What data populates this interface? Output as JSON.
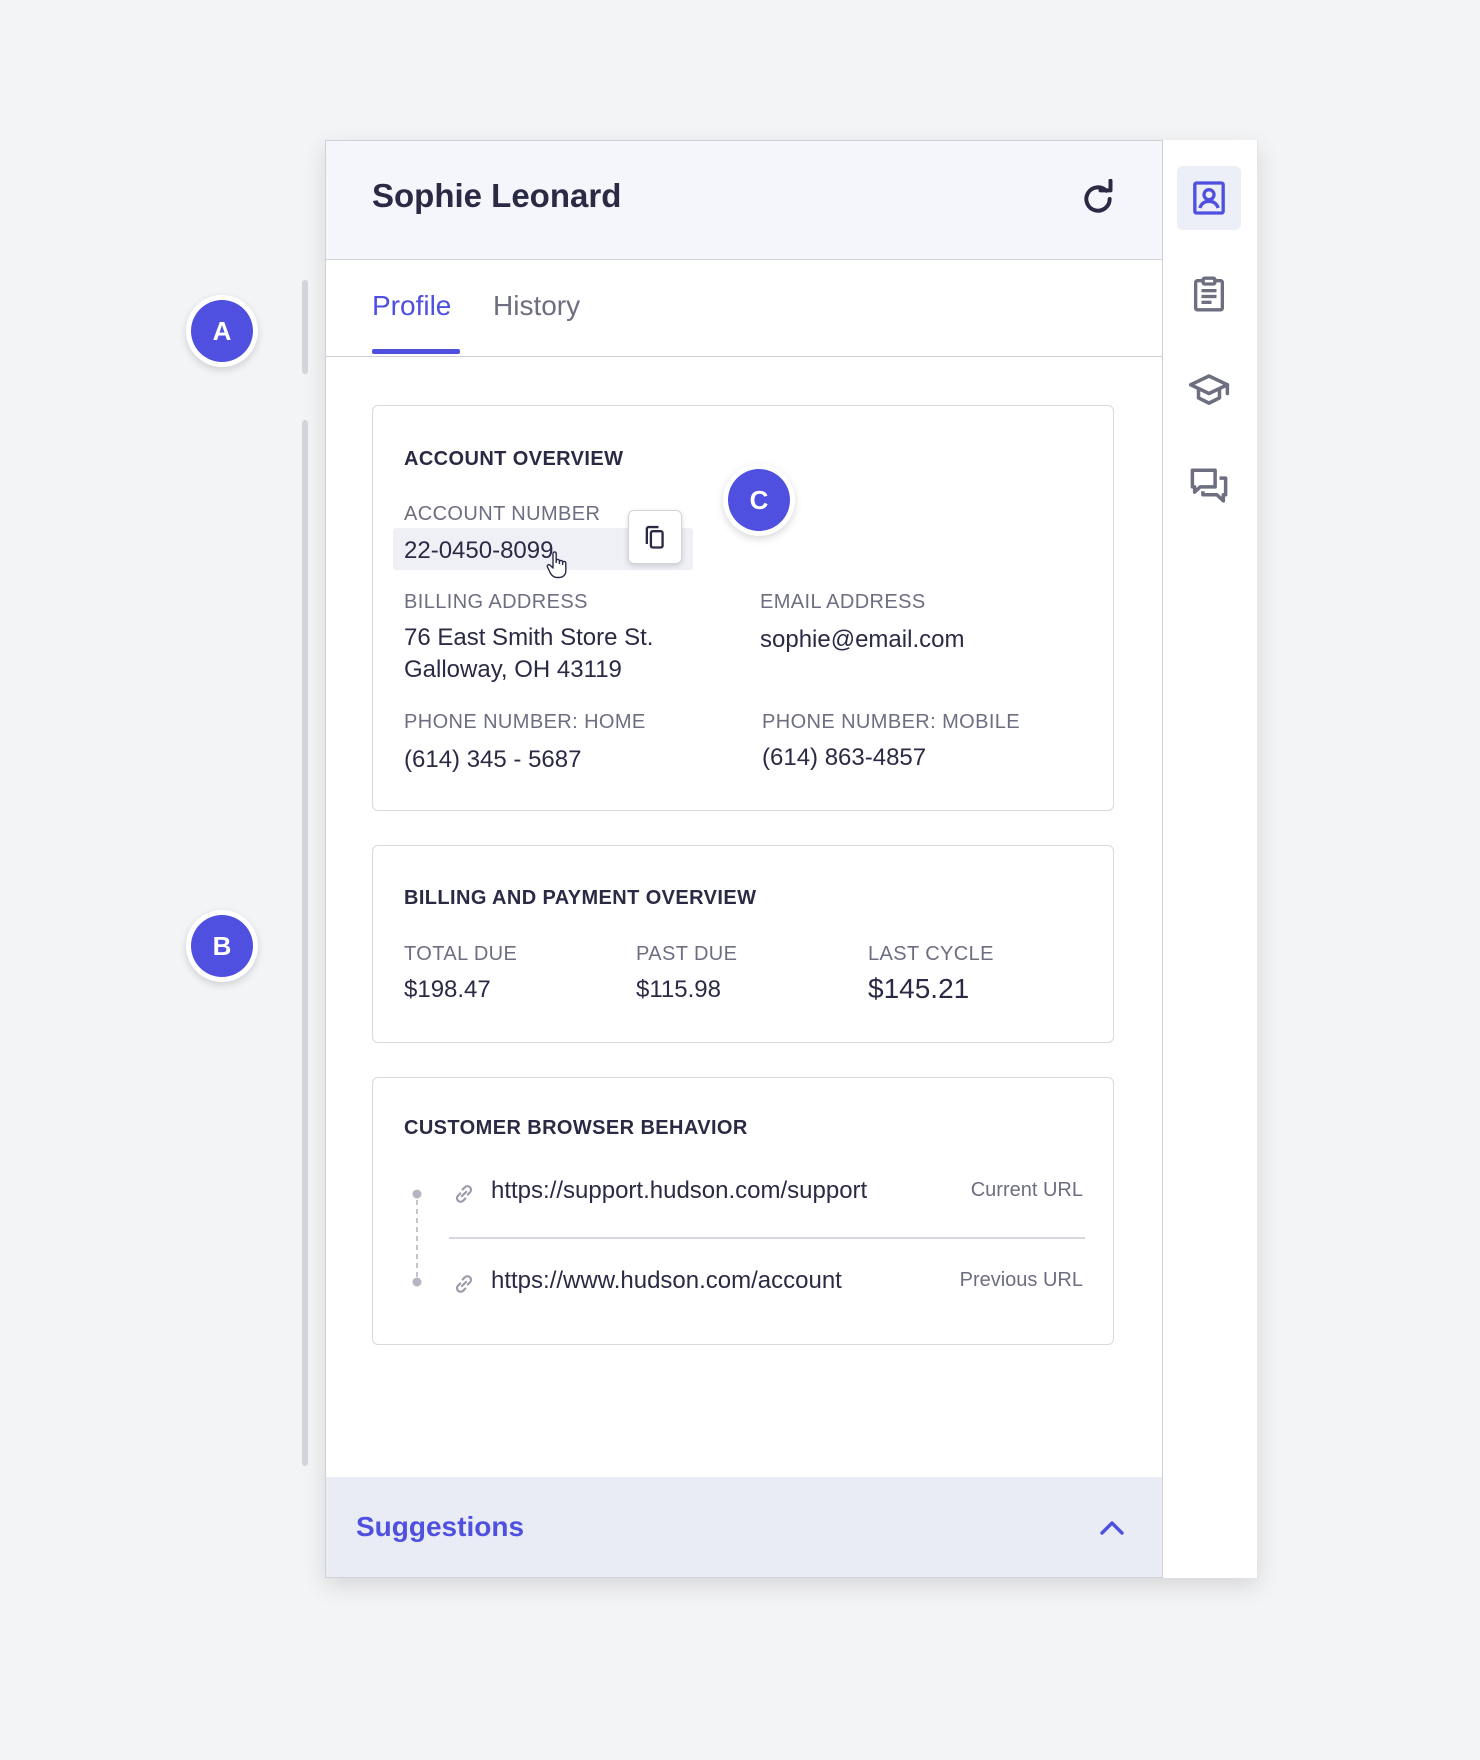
{
  "callouts": {
    "a": "A",
    "b": "B",
    "c": "C"
  },
  "header": {
    "name": "Sophie Leonard"
  },
  "tabs": [
    {
      "label": "Profile"
    },
    {
      "label": "History"
    }
  ],
  "account": {
    "title": "ACCOUNT OVERVIEW",
    "number_label": "ACCOUNT NUMBER",
    "number_value": "22-0450-8099",
    "billing_label": "BILLING ADDRESS",
    "billing_line1": "76 East Smith Store St.",
    "billing_line2": "Galloway, OH 43119",
    "email_label": "EMAIL ADDRESS",
    "email_value": "sophie@email.com",
    "phone_home_label": "PHONE NUMBER: HOME",
    "phone_home_value": "(614) 345 - 5687",
    "phone_mobile_label": "PHONE NUMBER: MOBILE",
    "phone_mobile_value": "(614) 863-4857"
  },
  "billing": {
    "title": "BILLING AND PAYMENT OVERVIEW",
    "total_label": "TOTAL DUE",
    "total_value": "$198.47",
    "past_label": "PAST DUE",
    "past_value": "$115.98",
    "last_label": "LAST CYCLE",
    "last_value": "$145.21"
  },
  "browser": {
    "title": "CUSTOMER BROWSER BEHAVIOR",
    "urls": [
      {
        "url": "https://support.hudson.com/support",
        "tag": "Current URL"
      },
      {
        "url": "https://www.hudson.com/account",
        "tag": "Previous URL"
      }
    ]
  },
  "suggestions": {
    "label": "Suggestions"
  },
  "rail": {
    "items": [
      "contact-card-icon",
      "clipboard-icon",
      "graduation-cap-icon",
      "chat-icon"
    ]
  },
  "colors": {
    "accent": "#4f50e0",
    "text": "#2b2a45",
    "muted": "#6d6e80"
  }
}
